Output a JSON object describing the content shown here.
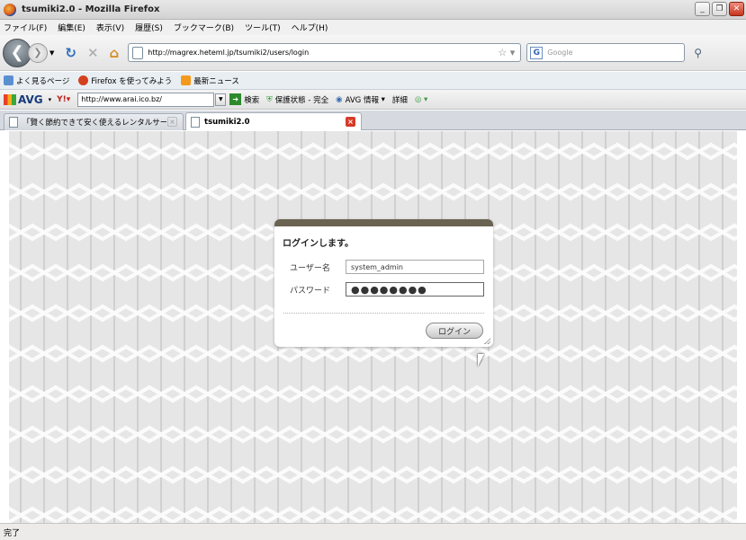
{
  "window": {
    "title": "tsumiki2.0 - Mozilla Firefox"
  },
  "menu": [
    "ファイル(F)",
    "編集(E)",
    "表示(V)",
    "履歴(S)",
    "ブックマーク(B)",
    "ツール(T)",
    "ヘルプ(H)"
  ],
  "nav": {
    "url": "http://magrex.heteml.jp/tsumiki2/users/login",
    "search_placeholder": "Google"
  },
  "bookmarks": [
    "よく見るページ",
    "Firefox を使ってみよう",
    "最新ニュース"
  ],
  "avg": {
    "logo": "AVG",
    "url": "http://www.arai.ico.bz/",
    "search": "検索",
    "protect": "保護状態 - 完全",
    "info": "AVG 情報",
    "detail": "詳細"
  },
  "tabs": [
    {
      "label": "「賢く節約できて安く使えるレンタルサーバ..."
    },
    {
      "label": "tsumiki2.0"
    }
  ],
  "login": {
    "title": "ログインします。",
    "username_label": "ユーザー名",
    "username_value": "system_admin",
    "password_label": "パスワード",
    "password_mask": "●●●●●●●●",
    "button": "ログイン"
  },
  "status": {
    "text": "完了"
  },
  "colors": {
    "dialog_header": "#6b6352",
    "close_tab": "#d63a2a"
  }
}
